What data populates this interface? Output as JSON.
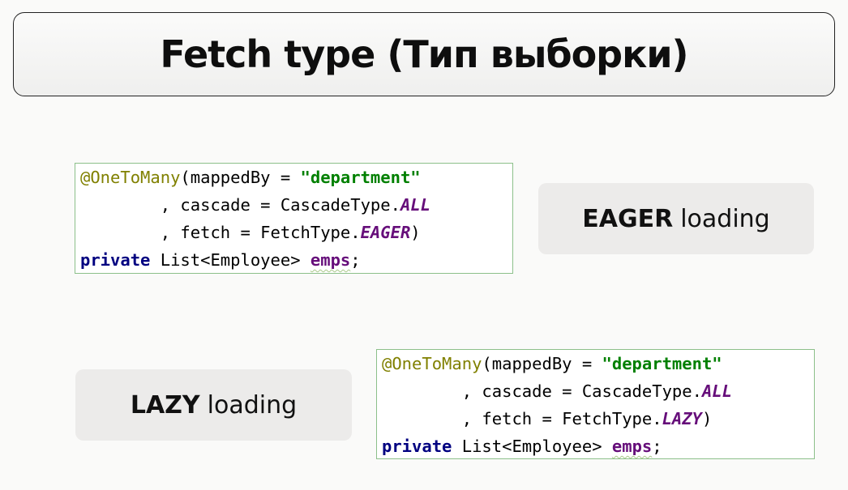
{
  "title": "Fetch type (Тип выборки)",
  "code_eager": {
    "annotation": "@OneToMany",
    "open": "(mappedBy = ",
    "mapped_value": "\"department\"",
    "cascade_prefix": "        , cascade = CascadeType.",
    "cascade_value": "ALL",
    "fetch_prefix": "        , fetch = FetchType.",
    "fetch_value": "EAGER",
    "close": ")",
    "keyword": "private",
    "type": " List<Employee> ",
    "field": "emps",
    "semicolon": ";"
  },
  "label_eager": {
    "strong": "EAGER",
    "rest": "loading"
  },
  "code_lazy": {
    "annotation": "@OneToMany",
    "open": "(mappedBy = ",
    "mapped_value": "\"department\"",
    "cascade_prefix": "        , cascade = CascadeType.",
    "cascade_value": "ALL",
    "fetch_prefix": "        , fetch = FetchType.",
    "fetch_value": "LAZY",
    "close": ")",
    "keyword": "private",
    "type": " List<Employee> ",
    "field": "emps",
    "semicolon": ";"
  },
  "label_lazy": {
    "strong": "LAZY",
    "rest": "loading"
  },
  "colors": {
    "annotation": "#808000",
    "string": "#008000",
    "keyword": "#000080",
    "constant": "#660e7a",
    "code_border": "#8cc08a",
    "label_bg": "#ecebea"
  }
}
